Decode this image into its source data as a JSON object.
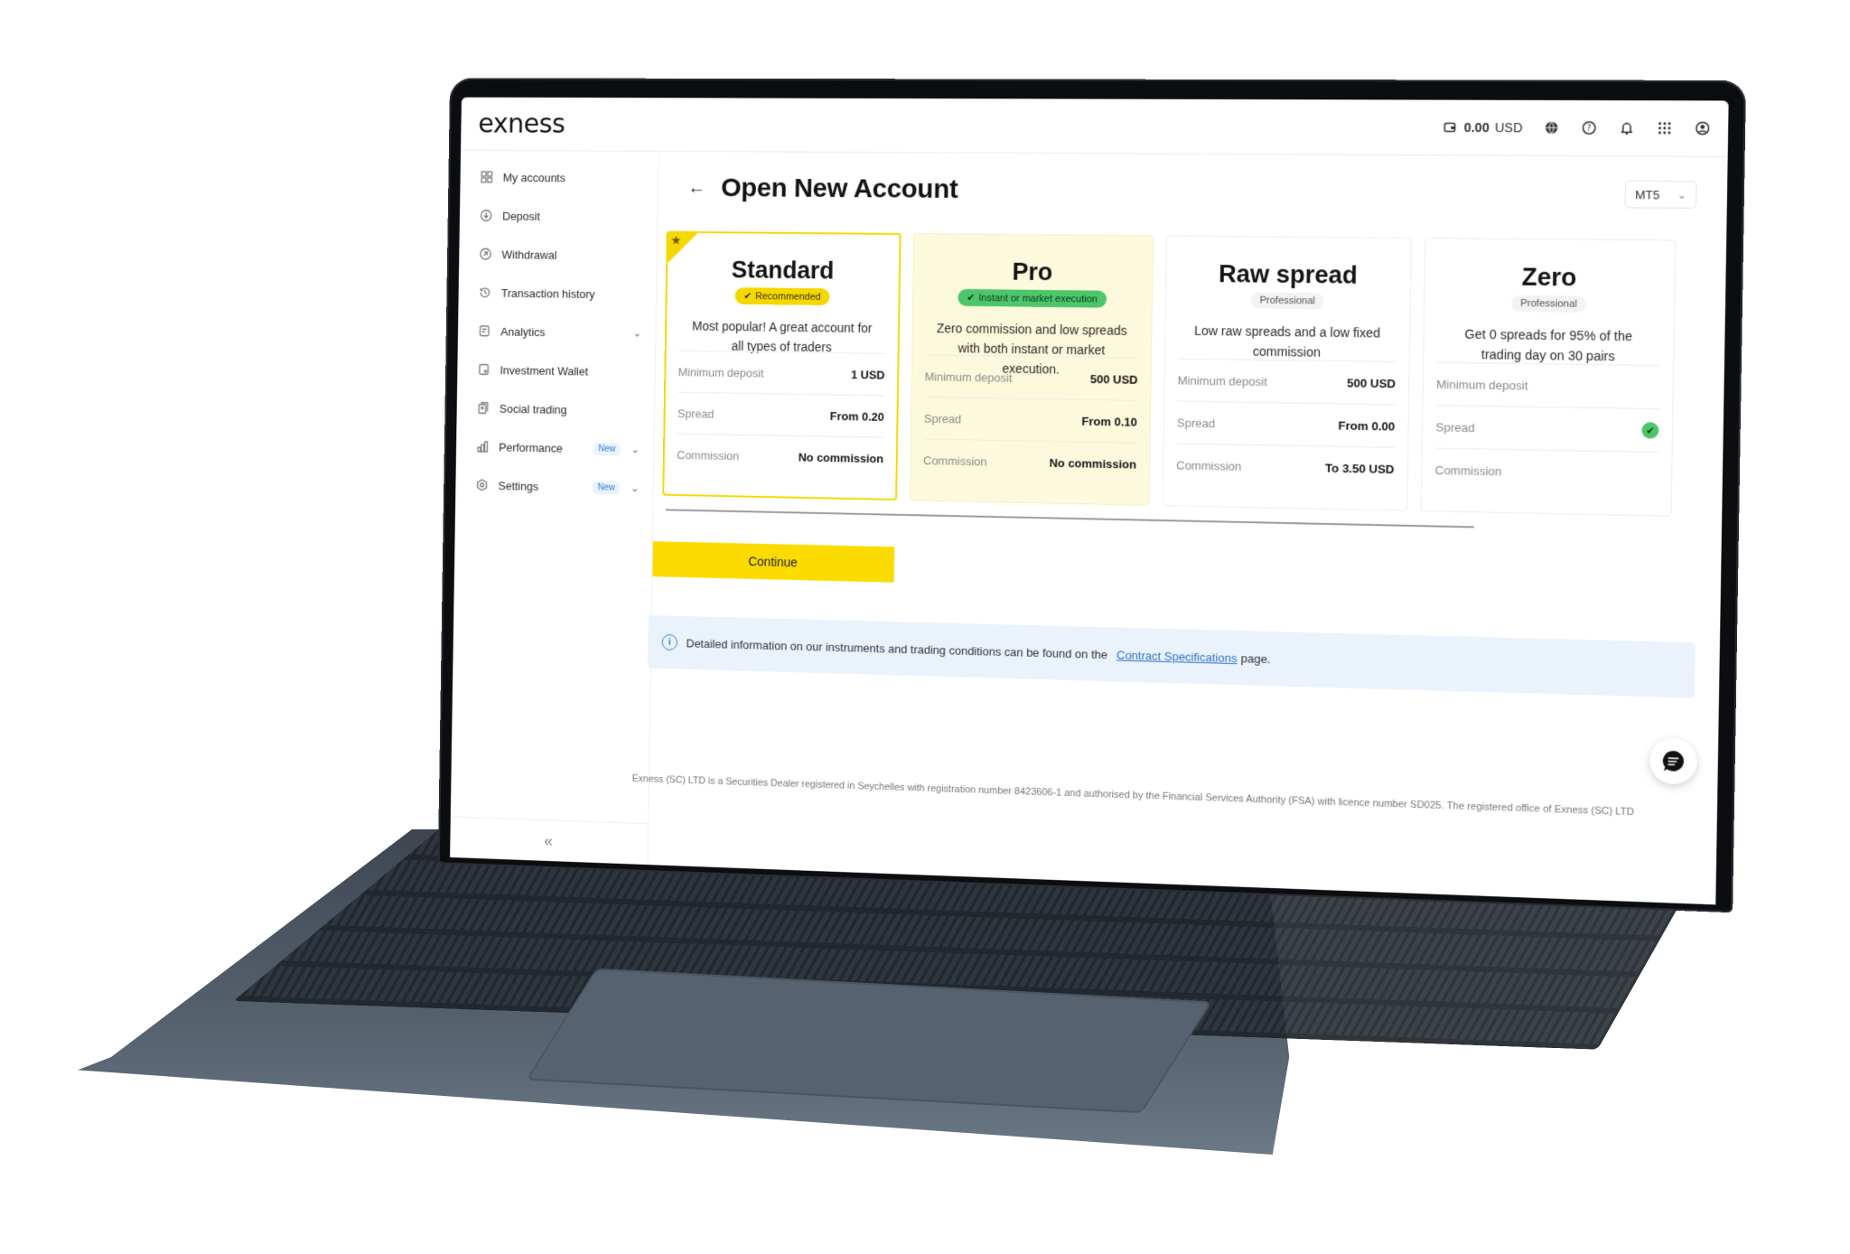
{
  "app": {
    "brand": "exness",
    "balance_amount": "0.00",
    "balance_currency": "USD",
    "header_icons": [
      "wallet-icon",
      "globe-icon",
      "help-icon",
      "bell-icon",
      "apps-grid-icon",
      "profile-icon"
    ]
  },
  "sidebar": {
    "items": [
      {
        "label": "My accounts",
        "icon": "accounts-grid-icon"
      },
      {
        "label": "Deposit",
        "icon": "deposit-icon"
      },
      {
        "label": "Withdrawal",
        "icon": "withdrawal-icon"
      },
      {
        "label": "Transaction history",
        "icon": "history-icon"
      },
      {
        "label": "Analytics",
        "icon": "analytics-icon",
        "expandable": true
      },
      {
        "label": "Investment Wallet",
        "icon": "wallet-icon"
      },
      {
        "label": "Social trading",
        "icon": "social-trading-icon"
      },
      {
        "label": "Performance",
        "icon": "performance-icon",
        "badge": "New",
        "expandable": true
      },
      {
        "label": "Settings",
        "icon": "settings-icon",
        "badge": "New",
        "expandable": true
      }
    ],
    "collapse_label": "«"
  },
  "main": {
    "title": "Open New Account",
    "platform": "MT5",
    "cards": [
      {
        "name": "Standard",
        "tag": "Recommended",
        "tag_style": "yellow",
        "selected": true,
        "description": "Most popular! A great account for all types of traders",
        "rows": [
          {
            "label": "Minimum deposit",
            "value": "1 USD"
          },
          {
            "label": "Spread",
            "value": "From 0.20"
          },
          {
            "label": "Commission",
            "value": "No commission"
          }
        ]
      },
      {
        "name": "Pro",
        "tag": "Instant or market execution",
        "tag_style": "green",
        "selected": false,
        "description": "Zero commission and low spreads with both instant or market execution.",
        "rows": [
          {
            "label": "Minimum deposit",
            "value": "500 USD"
          },
          {
            "label": "Spread",
            "value": "From 0.10"
          },
          {
            "label": "Commission",
            "value": "No commission"
          }
        ]
      },
      {
        "name": "Raw spread",
        "tag": "Professional",
        "tag_style": "grey",
        "selected": false,
        "description": "Low raw spreads and a low fixed commission",
        "rows": [
          {
            "label": "Minimum deposit",
            "value": "500 USD"
          },
          {
            "label": "Spread",
            "value": "From 0.00"
          },
          {
            "label": "Commission",
            "value": "To 3.50 USD"
          }
        ]
      },
      {
        "name": "Zero",
        "tag": "Professional",
        "tag_style": "grey",
        "selected": false,
        "description": "Get 0 spreads for 95% of the trading day on 30 pairs",
        "rows": [
          {
            "label": "Minimum deposit",
            "value": ""
          },
          {
            "label": "Spread",
            "value": ""
          },
          {
            "label": "Commission",
            "value": ""
          }
        ]
      }
    ],
    "continue_label": "Continue",
    "info": {
      "text_before": "Detailed information on our instruments and trading conditions can be found on the",
      "link": "Contract Specifications",
      "text_after": "page."
    },
    "footer": "Exness (SC) LTD is a Securities Dealer registered in Seychelles with registration number 8423606-1 and authorised by the Financial Services Authority (FSA) with licence number SD025. The registered office of Exness (SC) LTD"
  }
}
